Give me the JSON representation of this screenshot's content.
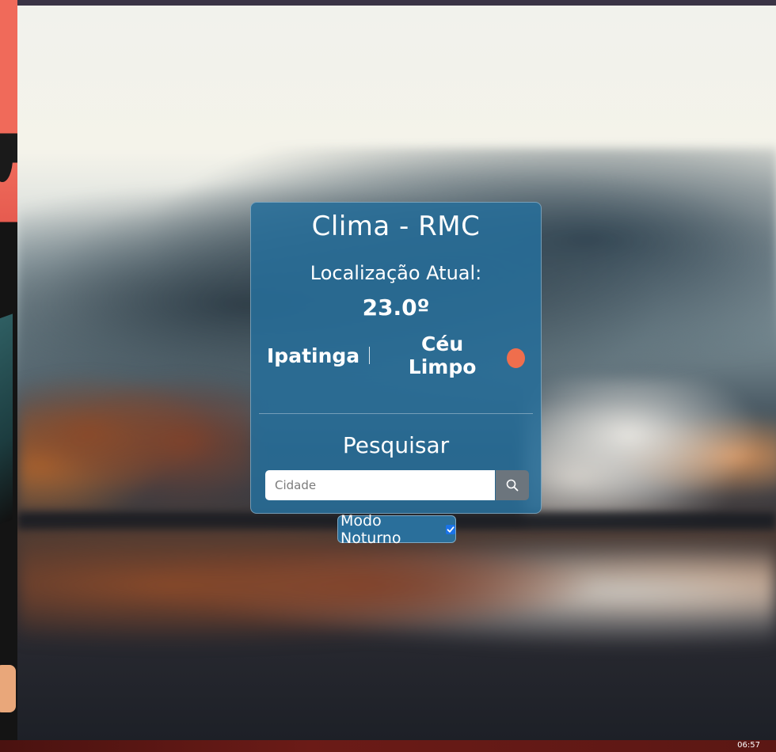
{
  "app": {
    "title": "Clima - RMC"
  },
  "current": {
    "location_label": "Localização Atual:",
    "temperature": "23.0º",
    "city": "Ipatinga",
    "condition": "Céu Limpo",
    "condition_icon": "sun-icon"
  },
  "search": {
    "title": "Pesquisar",
    "placeholder": "Cidade",
    "value": "",
    "button_icon": "search-icon"
  },
  "night_mode": {
    "label": "Modo Noturno",
    "checked": true
  },
  "taskbar": {
    "clock": "06:57"
  },
  "colors": {
    "card": "#276d99",
    "sun": "#ef6e4d",
    "search_button": "#6c757d",
    "checkbox": "#1a73e8"
  }
}
